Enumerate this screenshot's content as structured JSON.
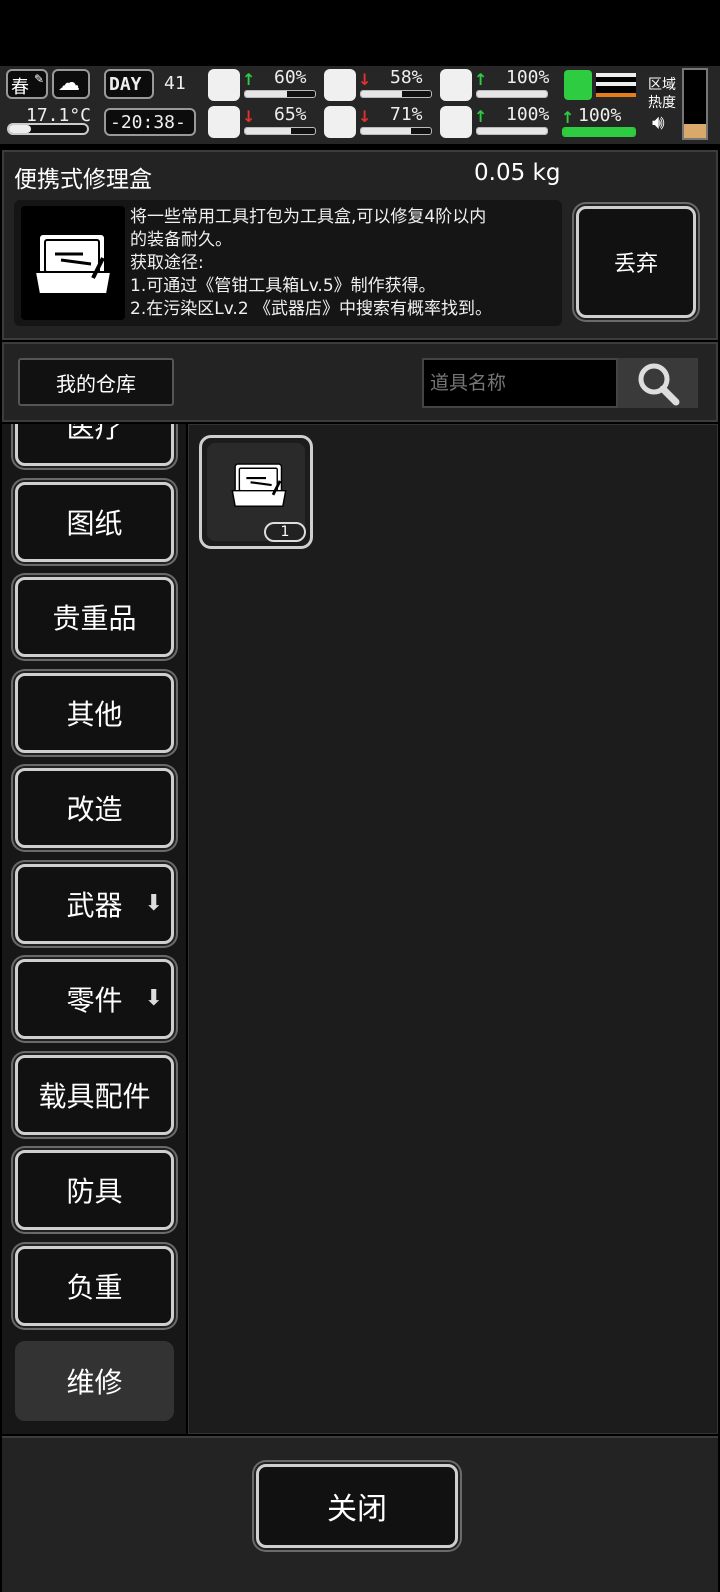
{
  "hud": {
    "season": "春",
    "day_label": "DAY",
    "day_value": "41",
    "temperature": "17.1°C",
    "time": "-20:38-",
    "zone_heat_line1": "区域",
    "zone_heat_line2": "热度",
    "stats": [
      {
        "icon": "medkit-icon",
        "trend": "up",
        "value": "60%",
        "fill": 0.6
      },
      {
        "icon": "stomach-icon",
        "trend": "down",
        "value": "58%",
        "fill": 0.58
      },
      {
        "icon": "shield-icon",
        "trend": "up",
        "value": "100%",
        "fill": 1.0
      },
      {
        "icon": "brain-icon",
        "trend": "down",
        "value": "65%",
        "fill": 0.65
      },
      {
        "icon": "water-drop-icon",
        "trend": "down",
        "value": "71%",
        "fill": 0.71
      },
      {
        "icon": "heart-icon",
        "trend": "up",
        "value": "100%",
        "fill": 1.0
      }
    ],
    "stamina": {
      "trend": "up",
      "value": "100%",
      "fill": 1.0
    }
  },
  "item": {
    "name": "便携式修理盒",
    "weight": "0.05 kg",
    "description": [
      "将一些常用工具打包为工具盒,可以修复4阶以内",
      "的装备耐久。",
      "获取途径:",
      "1.可通过《管钳工具箱Lv.5》制作获得。",
      "2.在污染区Lv.2 《武器店》中搜索有概率找到。"
    ],
    "discard_label": "丢弃"
  },
  "storage": {
    "my_storage_label": "我的仓库",
    "search_placeholder": "道具名称"
  },
  "categories": [
    {
      "label": "医疗"
    },
    {
      "label": "图纸"
    },
    {
      "label": "贵重品"
    },
    {
      "label": "其他"
    },
    {
      "label": "改造"
    },
    {
      "label": "武器",
      "has_arrow": true
    },
    {
      "label": "零件",
      "has_arrow": true
    },
    {
      "label": "载具配件"
    },
    {
      "label": "防具"
    },
    {
      "label": "负重"
    },
    {
      "label": "维修",
      "selected": true
    }
  ],
  "grid_items": [
    {
      "icon": "repair-toolbox-icon",
      "count": "1"
    }
  ],
  "close_label": "关闭",
  "colors": {
    "up": "#2ecc40",
    "down": "#e53030",
    "stamina": "#2ecc40"
  }
}
